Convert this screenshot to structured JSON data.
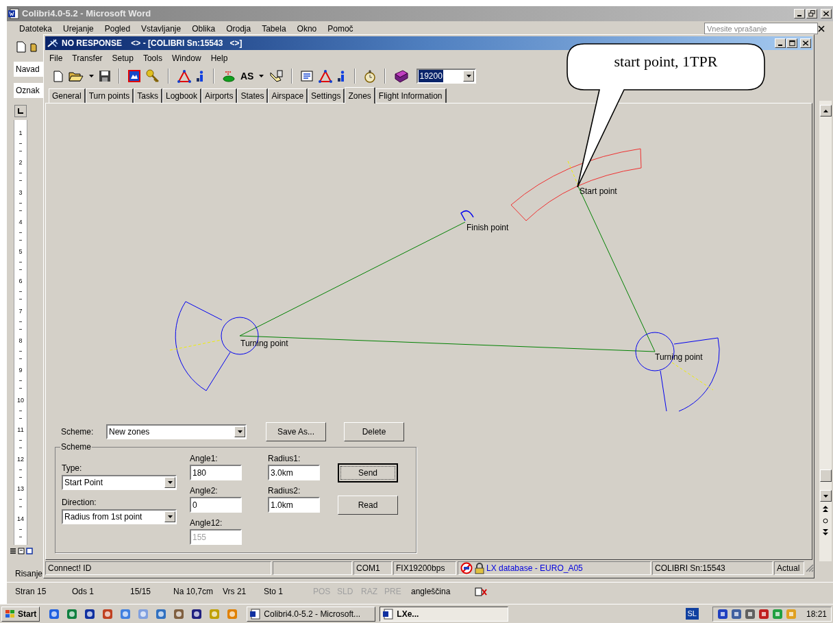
{
  "word": {
    "title": "Colibri4.0-5.2 - Microsoft Word",
    "menu": [
      "Datoteka",
      "Urejanje",
      "Pogled",
      "Vstavljanje",
      "Oblika",
      "Orodja",
      "Tabela",
      "Okno",
      "Pomoč"
    ],
    "help_box": {
      "placeholder": "Vnesite vprašanje"
    },
    "style_box": "Navad",
    "second_box": "Oznak",
    "ruler_numbers": [
      "1",
      "2",
      "3",
      "4",
      "5",
      "6",
      "7",
      "8",
      "9",
      "10",
      "11",
      "12",
      "13",
      "14"
    ],
    "drawing_toolbar": "Risanje",
    "status_bar": [
      {
        "text": "Stran 15",
        "disabled": false
      },
      {
        "text": "Ods 1",
        "disabled": false
      },
      {
        "text": "15/15",
        "disabled": false
      },
      {
        "text": "Na 10,7cm",
        "disabled": false
      },
      {
        "text": "Vrs 21",
        "disabled": false
      },
      {
        "text": "Sto 1",
        "disabled": false
      },
      {
        "text": "POS",
        "disabled": true
      },
      {
        "text": "SLD",
        "disabled": true
      },
      {
        "text": "RAZ",
        "disabled": true
      },
      {
        "text": "PRE",
        "disabled": true
      },
      {
        "text": "angleščina",
        "disabled": false
      }
    ]
  },
  "lxe": {
    "title": "NO RESPONSE    <> - [COLIBRI Sn:15543   <>]",
    "menu": [
      "File",
      "Transfer",
      "Setup",
      "Tools",
      "Window",
      "Help"
    ],
    "toolbar_text": "AS",
    "baud_combo": {
      "value": "19200",
      "text_selected": true
    },
    "tabs": [
      {
        "label": "General",
        "selected": false
      },
      {
        "label": "Turn points",
        "selected": false
      },
      {
        "label": "Tasks",
        "selected": false
      },
      {
        "label": "Logbook",
        "selected": false
      },
      {
        "label": "Airports",
        "selected": false
      },
      {
        "label": "States",
        "selected": false
      },
      {
        "label": "Airspace",
        "selected": false
      },
      {
        "label": "Settings",
        "selected": false
      },
      {
        "label": "Zones",
        "selected": true
      },
      {
        "label": "Flight Information",
        "selected": false
      }
    ],
    "map_labels": [
      "Start point",
      "Finish point",
      "Turning point",
      "Turning point"
    ],
    "callout": "start point, 1TPR",
    "zones_form": {
      "scheme_label": "Scheme:",
      "scheme_value": "New zones",
      "save_as": "Save As...",
      "delete": "Delete",
      "group_title": "Scheme",
      "type_label": "Type:",
      "type_value": "Start Point",
      "direction_label": "Direction:",
      "direction_value": "Radius from 1st point",
      "fields": [
        {
          "label": "Angle1:",
          "value": "180",
          "disabled": false
        },
        {
          "label": "Angle2:",
          "value": "0",
          "disabled": false
        },
        {
          "label": "Angle12:",
          "value": "155",
          "disabled": true
        },
        {
          "label": "Radius1:",
          "value": "3.0km",
          "disabled": false
        },
        {
          "label": "Radius2:",
          "value": "1.0km",
          "disabled": false
        }
      ],
      "buttons": [
        {
          "label": "Send",
          "default": true
        },
        {
          "label": "Read",
          "default": false
        }
      ]
    },
    "status_bar": [
      "Connect! ID",
      "COM1",
      "FIX19200bps",
      "LX database - EURO_A05",
      "COLIBRI Sn:15543",
      "Actual"
    ]
  },
  "taskbar": {
    "start": "Start",
    "tasks": [
      {
        "label": "Colibri4.0-5.2 - Microsoft...",
        "selected": false
      },
      {
        "label": "LXe...",
        "selected": true
      }
    ],
    "language": "SL",
    "clock": "18:21"
  }
}
